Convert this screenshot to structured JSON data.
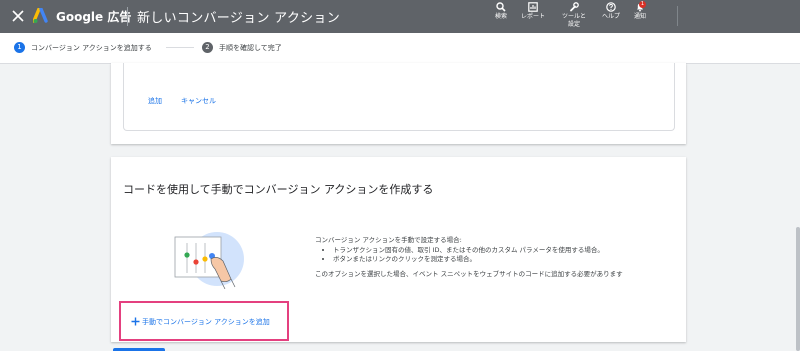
{
  "topbar": {
    "brand": "Google 広告",
    "title": "新しいコンバージョン アクション",
    "tools": [
      {
        "label": "検索",
        "icon": "search-icon"
      },
      {
        "label": "レポート",
        "icon": "reports-icon"
      },
      {
        "label": "ツールと\n設定",
        "icon": "wrench-icon"
      },
      {
        "label": "ヘルプ",
        "icon": "help-icon"
      },
      {
        "label": "通知",
        "icon": "bell-icon",
        "badge": "1"
      }
    ]
  },
  "stepper": {
    "steps": [
      {
        "number": "1",
        "label": "コンバージョン アクションを追加する",
        "active": true
      },
      {
        "number": "2",
        "label": "手順を確認して完了",
        "active": false
      }
    ]
  },
  "card1": {
    "add_label": "追加",
    "cancel_label": "キャンセル"
  },
  "card2": {
    "title": "コードを使用して手動でコンバージョン アクションを作成する",
    "desc_intro": "コンバージョン アクションを手動で設定する場合:",
    "bullets": [
      "トランザクション固有の値、取引 ID、またはその他のカスタム パラメータを使用する場合。",
      "ボタンまたはリンクのクリックを測定する場合。"
    ],
    "note": "このオプションを選択した場合、イベント スニペットをウェブサイトのコードに追加する必要があります",
    "add_manual_label": "手動でコンバージョン アクションを追加"
  },
  "colors": {
    "topbar": "#5f6368",
    "accent": "#1a73e8",
    "highlight": "#e4407f",
    "background": "#f1f3f4"
  }
}
